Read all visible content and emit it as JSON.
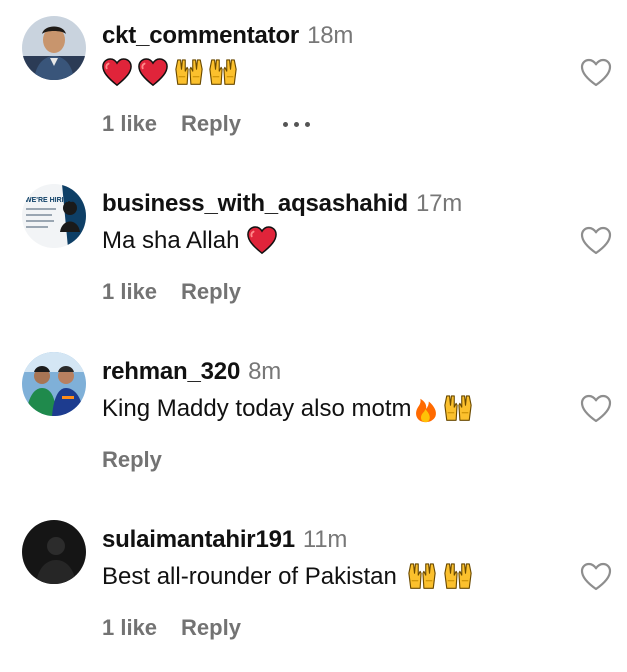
{
  "comments": [
    {
      "username": "ckt_commentator",
      "time": "18m",
      "text": "",
      "emojis": [
        "red-heart",
        "red-heart",
        "raising-hands",
        "raising-hands"
      ],
      "likes": "1 like",
      "reply": "Reply",
      "has_more": true
    },
    {
      "username": "business_with_aqsashahid",
      "time": "17m",
      "text": "Ma sha Allah",
      "emojis": [
        "red-heart"
      ],
      "likes": "1 like",
      "reply": "Reply",
      "avatar_text": "WE'RE HIRING"
    },
    {
      "username": "rehman_320",
      "time": "8m",
      "text": "King Maddy today also motm",
      "emojis": [
        "fire",
        "raising-hands"
      ],
      "likes": "",
      "reply": "Reply"
    },
    {
      "username": "sulaimantahir191",
      "time": "11m",
      "text": "Best all-rounder of Pakistan",
      "emojis": [
        "raising-hands",
        "raising-hands"
      ],
      "likes": "1 like",
      "reply": "Reply"
    }
  ],
  "colors": {
    "username": "#111111",
    "secondary": "#737373",
    "heart": "#e0245e",
    "emoji_yellow": "#fbc02d"
  }
}
